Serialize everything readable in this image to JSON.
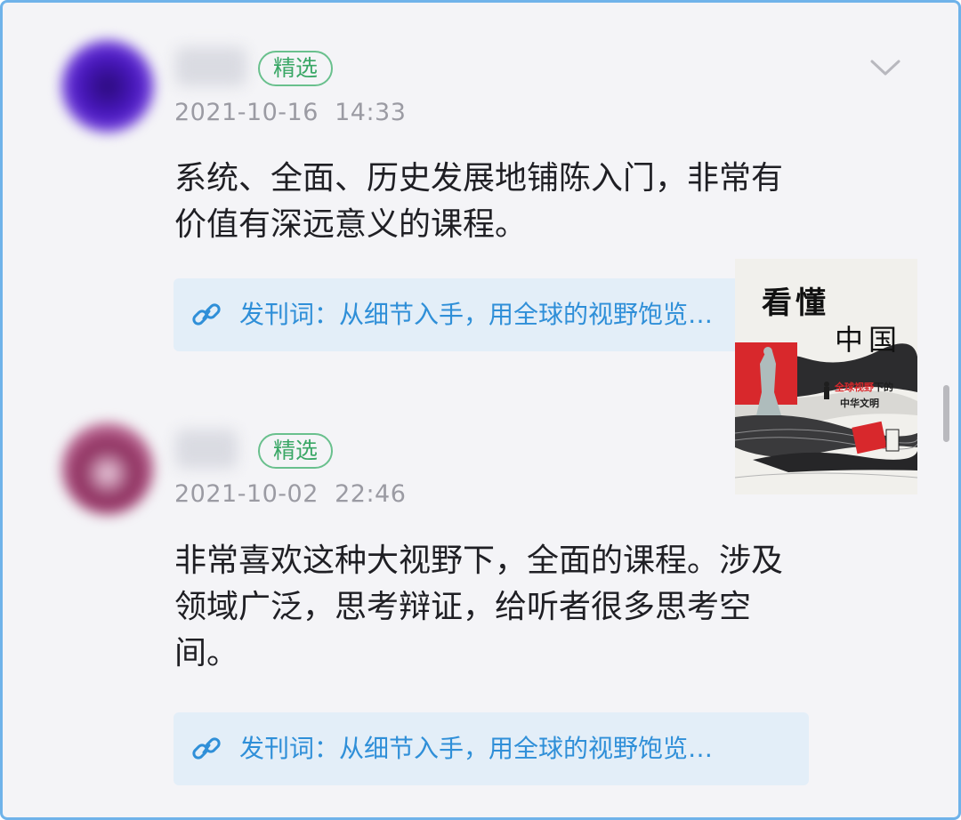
{
  "comments": [
    {
      "tag": "精选",
      "date": "2021-10-16",
      "time": "14:33",
      "text_lines": [
        "系统、全面、历史发展地铺陈入门，非常有",
        "价值有深远意义的课程。"
      ],
      "link_text": "发刊词：从细节入手，用全球的视野饱览…"
    },
    {
      "tag": "精选",
      "date": "2021-10-02",
      "time": "22:46",
      "text_lines": [
        "非常喜欢这种大视野下，全面的课程。涉及",
        "领域广泛，思考辩证，给听者很多思考空",
        "间。"
      ],
      "link_text": "发刊词：从细节入手，用全球的视野饱览…"
    }
  ],
  "cover": {
    "title_1": "看懂",
    "title_2": "中国",
    "subtitle_red": "全球视野",
    "subtitle_dark": "下的",
    "subtitle_2": "中华文明",
    "accent_color": "#d8282c"
  },
  "icons": {
    "expand": "chevron-down-icon",
    "link": "link-icon"
  }
}
